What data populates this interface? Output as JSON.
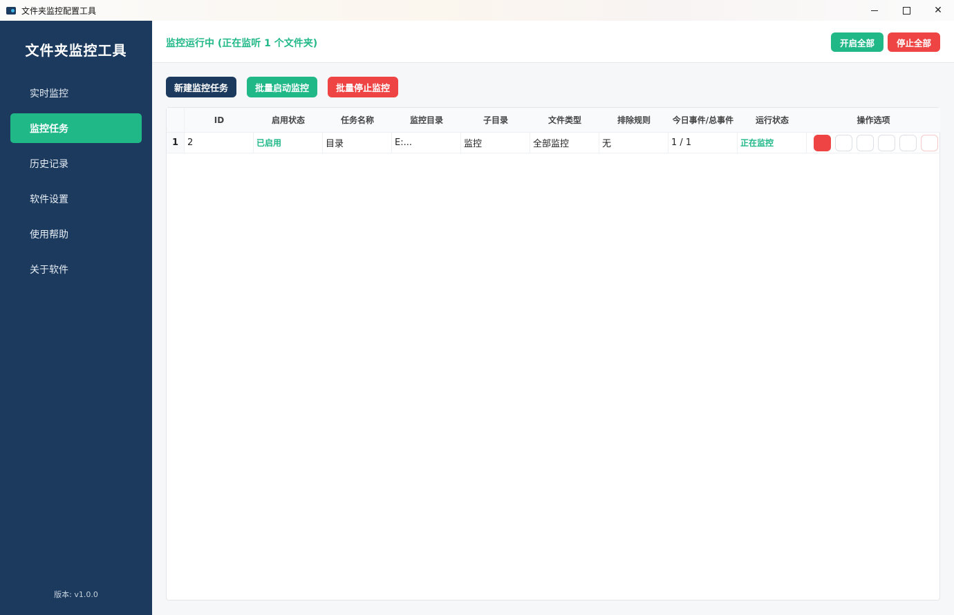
{
  "window": {
    "title": "文件夹监控配置工具"
  },
  "sidebar": {
    "brand": "文件夹监控工具",
    "items": [
      {
        "label": "实时监控",
        "active": false
      },
      {
        "label": "监控任务",
        "active": true
      },
      {
        "label": "历史记录",
        "active": false
      },
      {
        "label": "软件设置",
        "active": false
      },
      {
        "label": "使用帮助",
        "active": false
      },
      {
        "label": "关于软件",
        "active": false
      }
    ],
    "version": "版本: v1.0.0"
  },
  "header": {
    "status": "监控运行中 (正在监听 1 个文件夹)",
    "start_all": "开启全部",
    "stop_all": "停止全部"
  },
  "toolbar": {
    "new_task": "新建监控任务",
    "batch_start": "批量启动监控",
    "batch_stop": "批量停止监控"
  },
  "table": {
    "columns": [
      "ID",
      "启用状态",
      "任务名称",
      "监控目录",
      "子目录",
      "文件类型",
      "排除规则",
      "今日事件/总事件",
      "运行状态",
      "操作选项"
    ],
    "rows": [
      {
        "rownum": "1",
        "id": "2",
        "enabled": "已启用",
        "name": "目录",
        "dir": "E:...",
        "subdir": "监控",
        "file_type": "全部监控",
        "exclude": "无",
        "events": "1 / 1",
        "run_status": "正在监控"
      }
    ]
  },
  "colors": {
    "sidebar": "#1b3a5e",
    "accent": "#21b888",
    "danger": "#ef4444"
  }
}
